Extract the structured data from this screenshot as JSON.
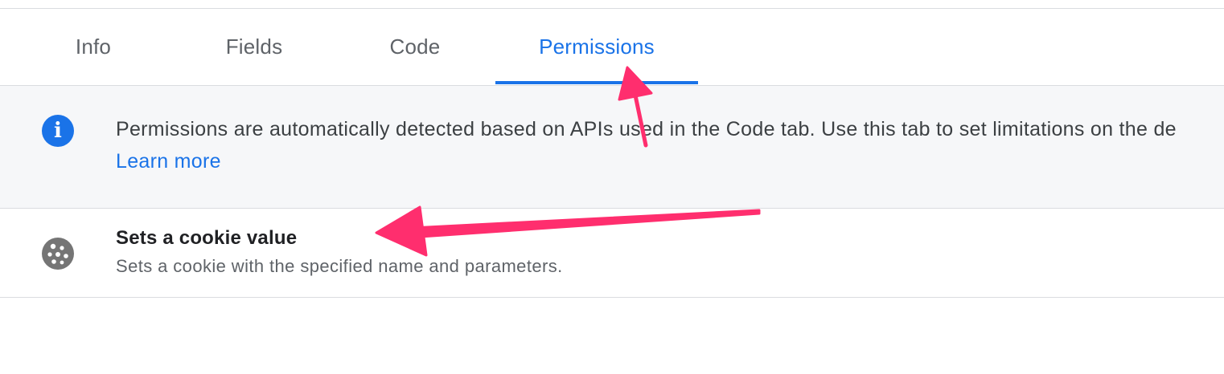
{
  "tabs": [
    {
      "label": "Info"
    },
    {
      "label": "Fields"
    },
    {
      "label": "Code"
    },
    {
      "label": "Permissions",
      "active": true
    }
  ],
  "info_banner": {
    "icon": "info-icon",
    "message": "Permissions are automatically detected based on APIs used in the Code tab. Use this tab to set limitations on the de",
    "link_label": "Learn more"
  },
  "permissions": [
    {
      "icon": "cookie-icon",
      "title": "Sets a cookie value",
      "description": "Sets a cookie with the specified name and parameters."
    }
  ],
  "colors": {
    "accent": "#1a73e8",
    "annotation_arrow": "#ff2e6e",
    "banner_bg": "#f6f7f9"
  }
}
